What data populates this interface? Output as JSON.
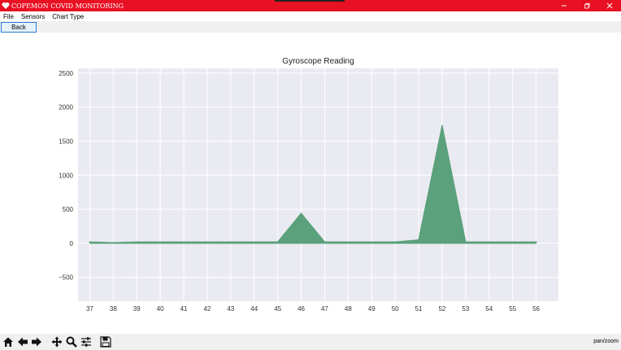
{
  "window": {
    "title": "COPEMON COVID MONITORING",
    "titlebar_color": "#e81123"
  },
  "menu": {
    "items": [
      "File",
      "Sensors",
      "Chart Type"
    ]
  },
  "buttons": {
    "back_label": "Back"
  },
  "toolbar": {
    "icons": [
      "home-icon",
      "back-arrow-icon",
      "forward-arrow-icon",
      "pan-icon",
      "zoom-icon",
      "configure-subplots-icon",
      "save-icon"
    ],
    "mode_label": "pan/zoom"
  },
  "chart_data": {
    "type": "area",
    "title": "Gyroscope Reading",
    "xlabel": "",
    "ylabel": "",
    "x": [
      37,
      38,
      39,
      40,
      41,
      42,
      43,
      44,
      45,
      46,
      47,
      48,
      49,
      50,
      51,
      52,
      53,
      54,
      55,
      56
    ],
    "values": [
      20,
      10,
      20,
      20,
      20,
      20,
      20,
      20,
      20,
      440,
      20,
      20,
      20,
      20,
      50,
      1730,
      20,
      20,
      20,
      20
    ],
    "yticks": [
      -500,
      0,
      500,
      1000,
      1500,
      2000,
      2500
    ],
    "ylim": [
      -850,
      2570
    ],
    "xlim": [
      36.5,
      56.95
    ],
    "grid": true,
    "fill_color": "#5ba17b",
    "background_color": "#eaeaf2"
  }
}
